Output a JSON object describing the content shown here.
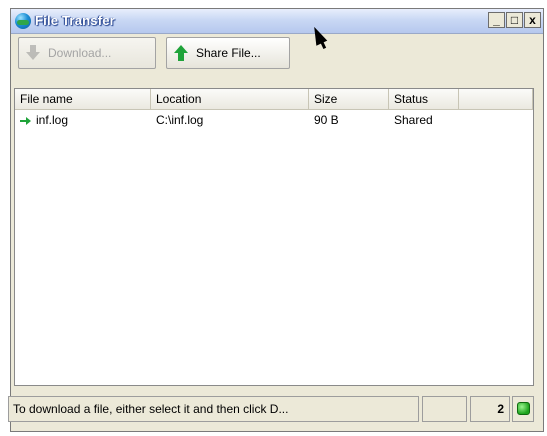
{
  "window": {
    "title": "File Transfer",
    "controls": {
      "minimize": "_",
      "maximize": "□",
      "close": "x"
    }
  },
  "toolbar": {
    "download_label": "Download...",
    "share_label": "Share File..."
  },
  "table": {
    "columns": [
      "File name",
      "Location",
      "Size",
      "Status",
      ""
    ],
    "rows": [
      {
        "name": "inf.log",
        "location": "C:\\inf.log",
        "size": "90 B",
        "status": "Shared"
      }
    ]
  },
  "statusbar": {
    "message": "To download a file, either select it and then click D...",
    "blank": "",
    "count": "2"
  },
  "colors": {
    "accent": "#1fa33a",
    "title_gradient": "#b6c8ee"
  }
}
